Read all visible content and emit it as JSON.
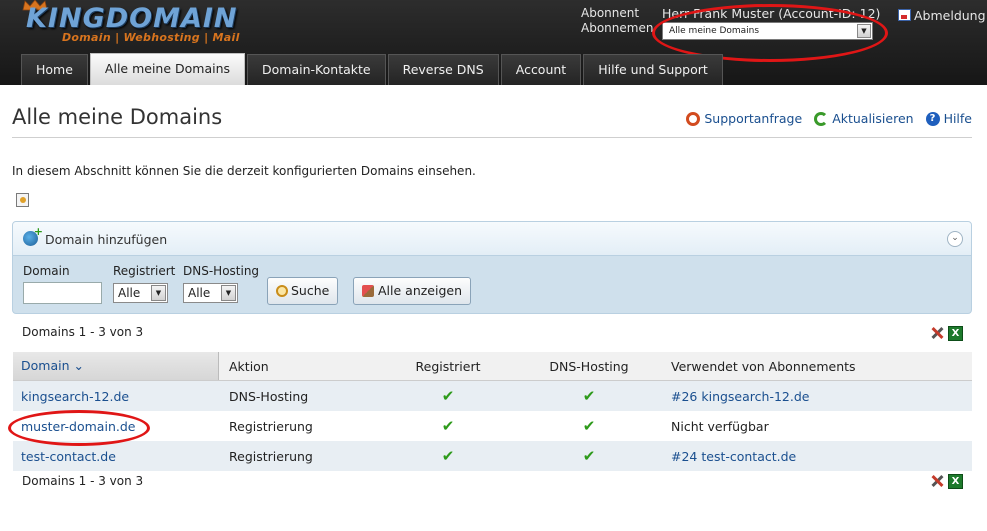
{
  "brand": {
    "name": "KINGDOMAIN",
    "tagline": "Domain | Webhosting | Mail"
  },
  "header": {
    "label_subscriber": "Abonnent",
    "label_subscriptions": "Abonnemen",
    "account_name": "Herr Frank Muster (Account-ID: 12)",
    "subscription_select": "Alle meine Domains",
    "logout": "Abmeldung"
  },
  "nav": {
    "tabs": [
      "Home",
      "Alle meine Domains",
      "Domain-Kontakte",
      "Reverse DNS",
      "Account",
      "Hilfe und Support"
    ],
    "active": "Alle meine Domains"
  },
  "page": {
    "title": "Alle meine Domains",
    "links": {
      "support": "Supportanfrage",
      "refresh": "Aktualisieren",
      "help": "Hilfe"
    },
    "intro": "In diesem Abschnitt können Sie die derzeit konfigurierten Domains einsehen."
  },
  "filter": {
    "panel_title": "Domain hinzufügen",
    "domain_label": "Domain",
    "domain_value": "",
    "registered_label": "Registriert",
    "registered_value": "Alle",
    "hosting_label": "DNS-Hosting",
    "hosting_value": "Alle",
    "search_button": "Suche",
    "show_all_button": "Alle anzeigen"
  },
  "table": {
    "count_text": "Domains 1 - 3 von 3",
    "columns": [
      "Domain ⌄",
      "Aktion",
      "Registriert",
      "DNS-Hosting",
      "Verwendet von Abonnements"
    ],
    "rows": [
      {
        "domain": "kingsearch-12.de",
        "action": "DNS-Hosting",
        "registered": "✔",
        "hosting": "✔",
        "used_by": "#26 kingsearch-12.de"
      },
      {
        "domain": "muster-domain.de",
        "action": "Registrierung",
        "registered": "✔",
        "hosting": "✔",
        "used_by": "Nicht verfügbar"
      },
      {
        "domain": "test-contact.de",
        "action": "Registrierung",
        "registered": "✔",
        "hosting": "✔",
        "used_by": "#24 test-contact.de"
      }
    ]
  },
  "colors": {
    "link": "#1a4f8f",
    "highlight_red": "#e01616",
    "check_green": "#2d9a1a",
    "panel_blue": "#cfe0ec",
    "header_dark": "#1f1f1f"
  }
}
